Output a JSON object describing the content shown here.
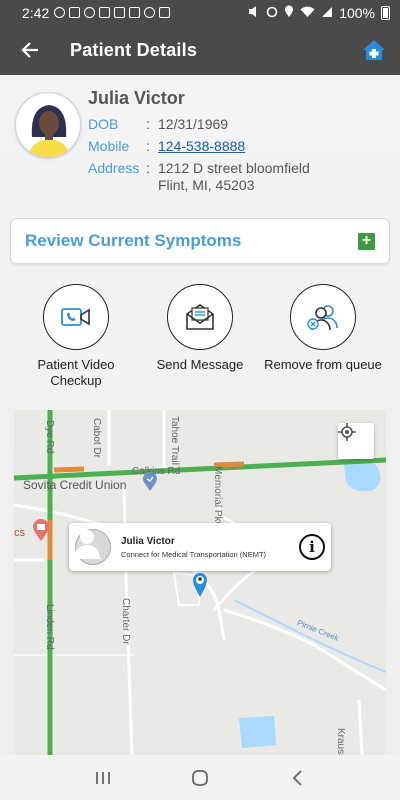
{
  "status": {
    "time": "2:42",
    "battery": "100%"
  },
  "header": {
    "title": "Patient Details",
    "back_icon": "arrow-left-icon",
    "home_icon": "home-medical-icon"
  },
  "patient": {
    "name": "Julia Victor",
    "dob_label": "DOB",
    "dob_value": "12/31/1969",
    "mobile_label": "Mobile",
    "mobile_value": "124-538-8888",
    "address_label": "Address",
    "address_line1": "1212 D street bloomfield",
    "address_line2": "Flint, MI, 45203",
    "colon": ":"
  },
  "symptoms": {
    "label": "Review Current Symptoms",
    "add": "+"
  },
  "actions": [
    {
      "label": "Patient Video\nCheckup",
      "icon": "video-call-icon"
    },
    {
      "label": "Send Message",
      "icon": "envelope-icon"
    },
    {
      "label": "Remove from queue",
      "icon": "remove-user-icon"
    }
  ],
  "map": {
    "poi": "Sovita Credit Union",
    "poi_fragment": "cs",
    "streets": [
      "Cabot Dr",
      "Tahoe Trail",
      "Calkins Rd",
      "Memorial Pkwy",
      "Charter Dr",
      "Pirnie Creek",
      "Dye Rd",
      "Linden Rd",
      "Krauss"
    ],
    "marker_card": {
      "name": "Julia Victor",
      "subtitle": "Connect for Medical Transportation (NEMT)",
      "info": "i"
    },
    "colors": {
      "road_green": "#4caf50",
      "road_orange": "#e08a3a",
      "water": "#aadaff",
      "marker": "#2a8ed6"
    }
  },
  "nav": [
    "recents-icon",
    "home-circle-icon",
    "back-chevron-icon"
  ]
}
